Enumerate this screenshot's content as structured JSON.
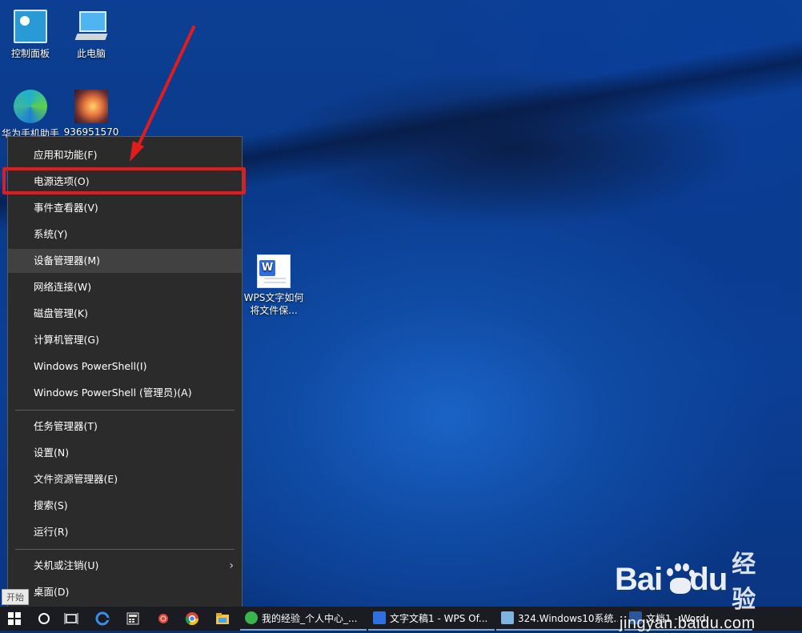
{
  "desktop": {
    "icons": [
      {
        "label": "控制面板"
      },
      {
        "label": "此电脑"
      },
      {
        "label": "华为手机助手"
      },
      {
        "label": "936951570"
      },
      {
        "label": "WPS文字如何将文件保..."
      }
    ]
  },
  "context_menu": {
    "group1": [
      {
        "label": "应用和功能(F)"
      },
      {
        "label": "电源选项(O)"
      },
      {
        "label": "事件查看器(V)"
      },
      {
        "label": "系统(Y)"
      },
      {
        "label": "设备管理器(M)"
      },
      {
        "label": "网络连接(W)"
      },
      {
        "label": "磁盘管理(K)"
      },
      {
        "label": "计算机管理(G)"
      },
      {
        "label": "Windows PowerShell(I)"
      },
      {
        "label": "Windows PowerShell (管理员)(A)"
      }
    ],
    "group2": [
      {
        "label": "任务管理器(T)"
      },
      {
        "label": "设置(N)"
      },
      {
        "label": "文件资源管理器(E)"
      },
      {
        "label": "搜索(S)"
      },
      {
        "label": "运行(R)"
      }
    ],
    "group3": [
      {
        "label": "关机或注销(U)"
      },
      {
        "label": "桌面(D)"
      }
    ],
    "highlighted_item": "电源选项(O)",
    "hover_item": "设备管理器(M)"
  },
  "start_tooltip": "开始",
  "taskbar": {
    "apps": [
      {
        "label": "我的经验_个人中心_...",
        "icon": "ie-green-icon",
        "color": "#39b54a"
      },
      {
        "label": "文字文稿1 - WPS Of...",
        "icon": "wps-writer-icon",
        "color": "#2f6fe0"
      },
      {
        "label": "324.Windows10系统...",
        "icon": "notepad-icon",
        "color": "#7fb3e0"
      },
      {
        "label": "文档1 - Word",
        "icon": "word-icon",
        "color": "#2b579a"
      }
    ]
  },
  "watermark": {
    "brand": "Bai",
    "brand_suffix": "du",
    "cn": "经验",
    "url": "jingyan.baidu.com"
  },
  "colors": {
    "menu_bg": "#2b2b2b",
    "highlight": "#e31b1b",
    "taskbar_bg": "#1a1c22"
  }
}
